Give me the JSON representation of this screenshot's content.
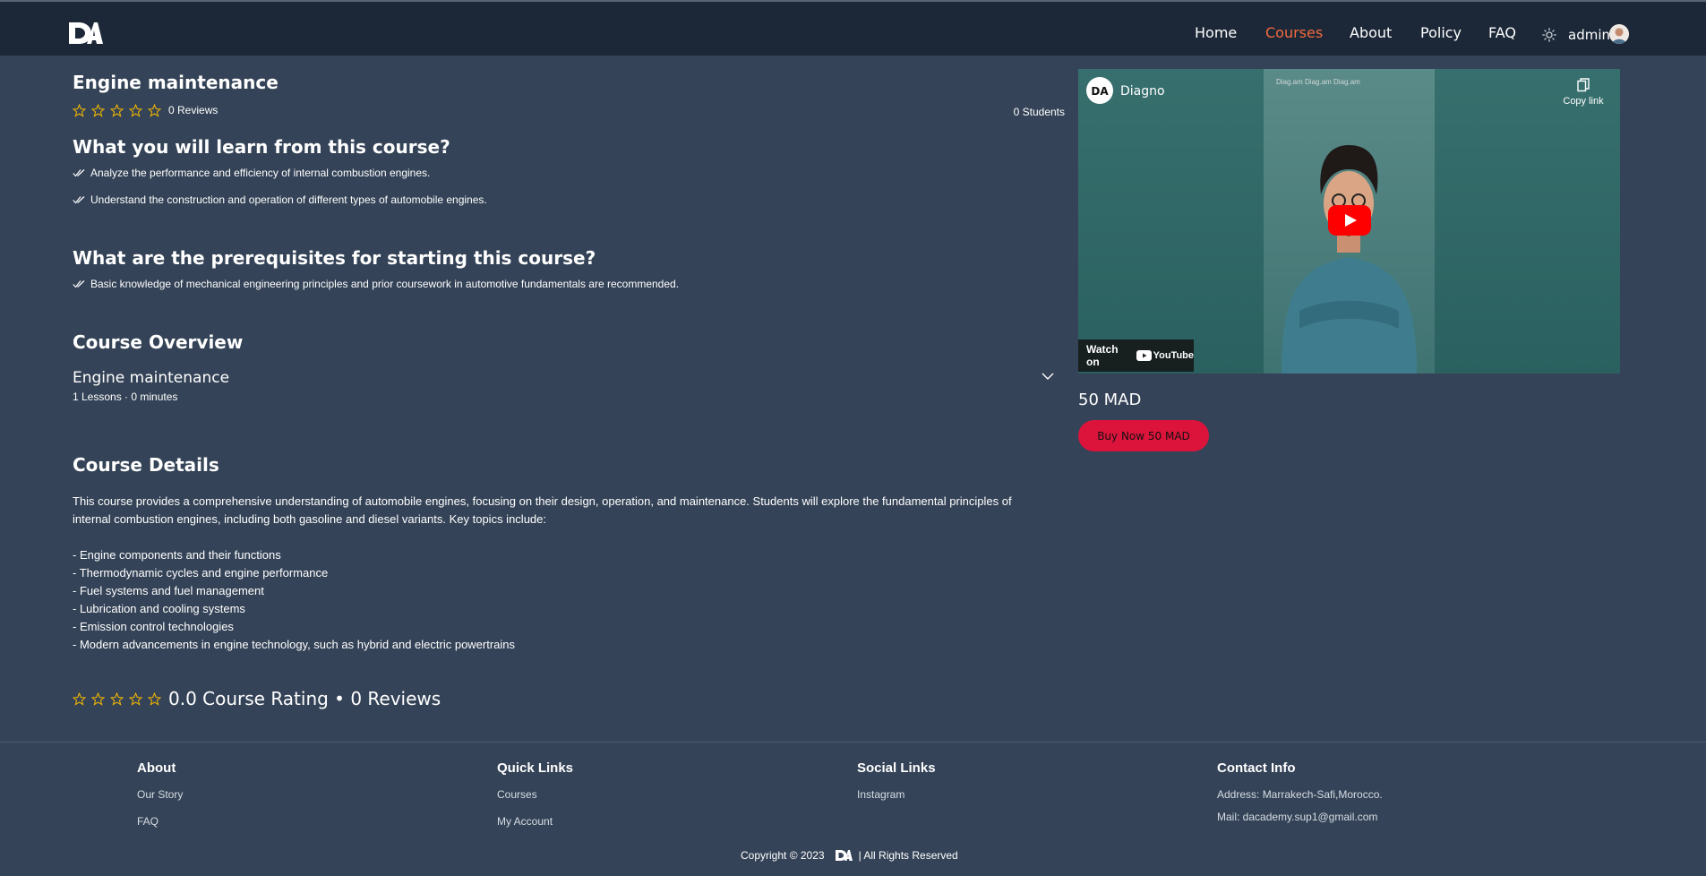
{
  "header": {
    "logo_text": "DA",
    "nav": [
      {
        "label": "Home",
        "active": false
      },
      {
        "label": "Courses",
        "active": true
      },
      {
        "label": "About",
        "active": false
      },
      {
        "label": "Policy",
        "active": false
      },
      {
        "label": "FAQ",
        "active": false
      }
    ],
    "user_name": "admin",
    "accent_color": "#f26a3d"
  },
  "course": {
    "title": "Engine maintenance",
    "reviews_label": "0 Reviews",
    "students_label": "0 Students",
    "rating_stars": 0,
    "learn_heading": "What you will learn from this course?",
    "learn_items": [
      "Analyze the performance and efficiency of internal combustion engines.",
      "Understand the construction and operation of different types of automobile engines."
    ],
    "prereq_heading": "What are the prerequisites for starting this course?",
    "prereq_items": [
      "Basic knowledge of mechanical engineering principles and prior coursework in automotive fundamentals are recommended."
    ],
    "overview_heading": "Course Overview",
    "overview_section_title": "Engine maintenance",
    "overview_section_meta": "1 Lessons · 0 minutes",
    "details_heading": "Course Details",
    "details_lines": [
      "This course provides a comprehensive understanding of automobile engines, focusing on their design, operation, and maintenance. Students will explore the fundamental principles of",
      "internal combustion engines, including both gasoline and diesel variants. Key topics include:",
      "",
      "- Engine components and their functions",
      "- Thermodynamic cycles and engine performance",
      "- Fuel systems and fuel management",
      "- Lubrication and cooling systems",
      "- Emission control technologies",
      "- Modern advancements in engine technology, such as hybrid and electric powertrains"
    ],
    "rating_summary": "0.0 Course Rating • 0 Reviews"
  },
  "video": {
    "channel_name": "Diagno",
    "copy_link_label": "Copy link",
    "watch_on_label": "Watch on",
    "youtube_label": "YouTube",
    "social_strip": "Diag.am   Diag.am   Diag.am"
  },
  "purchase": {
    "price": "50 MAD",
    "buy_label": "Buy Now 50 MAD",
    "button_color": "#dc143c"
  },
  "footer": {
    "about": {
      "title": "About",
      "links": [
        "Our Story",
        "FAQ"
      ]
    },
    "quick": {
      "title": "Quick Links",
      "links": [
        "Courses",
        "My Account"
      ]
    },
    "social": {
      "title": "Social Links",
      "links": [
        "Instagram"
      ]
    },
    "contact": {
      "title": "Contact Info",
      "lines": [
        "Address: Marrakech-Safi,Morocco.",
        "Mail: dacademy.sup1@gmail.com"
      ]
    },
    "copyright_prefix": "Copyright © 2023",
    "copyright_suffix": "| All Rights Reserved"
  }
}
